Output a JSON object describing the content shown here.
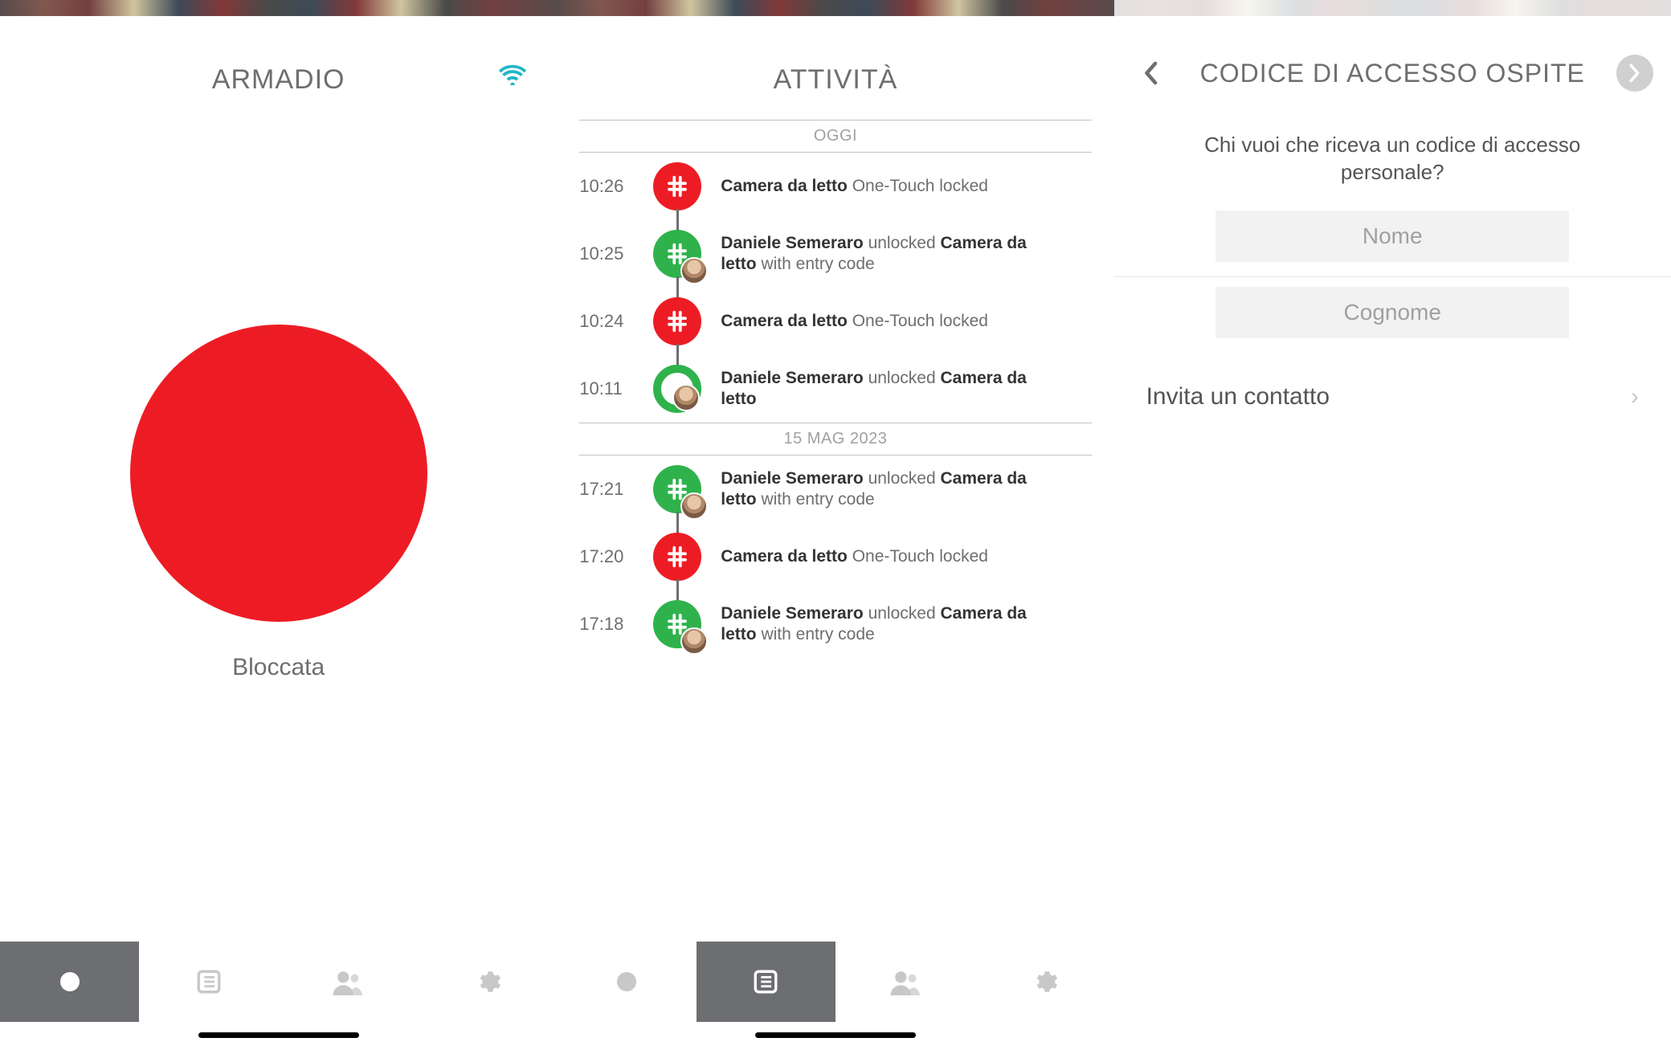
{
  "colors": {
    "lock_red": "#ed1c24",
    "ok_green": "#2fb24c",
    "text_grey": "#6d6e71"
  },
  "screen1": {
    "title": "ARMADIO",
    "lock_status": "Bloccata",
    "tabs": [
      "lock",
      "activity",
      "users",
      "settings"
    ],
    "active_tab": 0
  },
  "screen2": {
    "title": "ATTIVITÀ",
    "groups": [
      {
        "label": "OGGI",
        "events": [
          {
            "time": "10:26",
            "icon": "hash",
            "color": "red",
            "avatar": false,
            "bold1": "Camera da letto",
            "mid": " One-Touch locked",
            "bold2": "",
            "tail": ""
          },
          {
            "time": "10:25",
            "icon": "hash",
            "color": "green",
            "avatar": true,
            "bold1": "Daniele Semeraro",
            "mid": " unlocked ",
            "bold2": "Camera da letto",
            "tail": " with entry code"
          },
          {
            "time": "10:24",
            "icon": "hash",
            "color": "red",
            "avatar": false,
            "bold1": "Camera da letto",
            "mid": " One-Touch locked",
            "bold2": "",
            "tail": ""
          },
          {
            "time": "10:11",
            "icon": "ring",
            "color": "green",
            "avatar": true,
            "bold1": "Daniele Semeraro",
            "mid": " unlocked ",
            "bold2": "Camera da letto",
            "tail": ""
          }
        ]
      },
      {
        "label": "15 MAG 2023",
        "events": [
          {
            "time": "17:21",
            "icon": "hash",
            "color": "green",
            "avatar": true,
            "bold1": "Daniele Semeraro",
            "mid": " unlocked ",
            "bold2": "Camera da letto",
            "tail": " with entry code"
          },
          {
            "time": "17:20",
            "icon": "hash",
            "color": "red",
            "avatar": false,
            "bold1": "Camera da letto",
            "mid": " One-Touch locked",
            "bold2": "",
            "tail": ""
          },
          {
            "time": "17:18",
            "icon": "hash",
            "color": "green",
            "avatar": true,
            "bold1": "Daniele Semeraro",
            "mid": " unlocked ",
            "bold2": "Camera da letto",
            "tail": " with entry code"
          }
        ]
      }
    ],
    "tabs": [
      "lock",
      "activity",
      "users",
      "settings"
    ],
    "active_tab": 1
  },
  "screen3": {
    "title": "CODICE DI ACCESSO OSPITE",
    "prompt": "Chi vuoi che riceva un codice di accesso personale?",
    "name_placeholder": "Nome",
    "surname_placeholder": "Cognome",
    "invite_label": "Invita un contatto"
  }
}
